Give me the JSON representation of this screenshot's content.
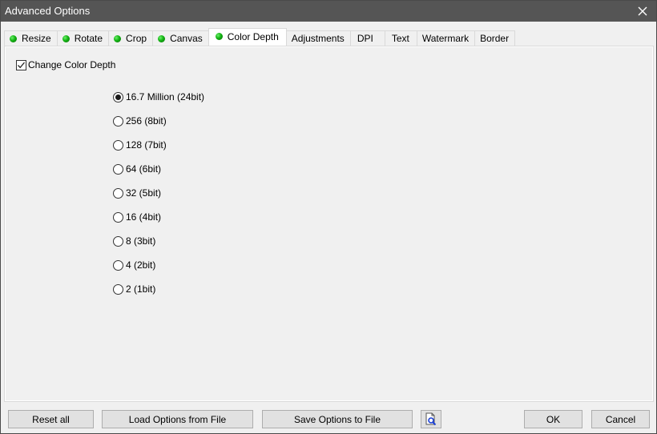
{
  "window": {
    "title": "Advanced Options",
    "close_icon": "close-x-icon"
  },
  "tabs": [
    {
      "label": "Resize",
      "status_dot": true,
      "active": false
    },
    {
      "label": "Rotate",
      "status_dot": true,
      "active": false
    },
    {
      "label": "Crop",
      "status_dot": true,
      "active": false
    },
    {
      "label": "Canvas",
      "status_dot": true,
      "active": false
    },
    {
      "label": "Color Depth",
      "status_dot": true,
      "active": true
    },
    {
      "label": "Adjustments",
      "status_dot": false,
      "active": false
    },
    {
      "label": "DPI",
      "status_dot": false,
      "active": false
    },
    {
      "label": "Text",
      "status_dot": false,
      "active": false
    },
    {
      "label": "Watermark",
      "status_dot": false,
      "active": false
    },
    {
      "label": "Border",
      "status_dot": false,
      "active": false
    }
  ],
  "colors": {
    "status_dot": "#12b312",
    "titlebar": "#555555"
  },
  "color_depth": {
    "change_label": "Change Color Depth",
    "change_checked": true,
    "selected_index": 0,
    "options": [
      "16.7 Million (24bit)",
      "256 (8bit)",
      "128 (7bit)",
      "64 (6bit)",
      "32 (5bit)",
      "16 (4bit)",
      "8 (3bit)",
      "4 (2bit)",
      "2 (1bit)"
    ]
  },
  "footer": {
    "reset_label": "Reset all",
    "load_label": "Load Options from File",
    "save_label": "Save Options to File",
    "preview_icon": "document-search-icon",
    "ok_label": "OK",
    "cancel_label": "Cancel"
  }
}
